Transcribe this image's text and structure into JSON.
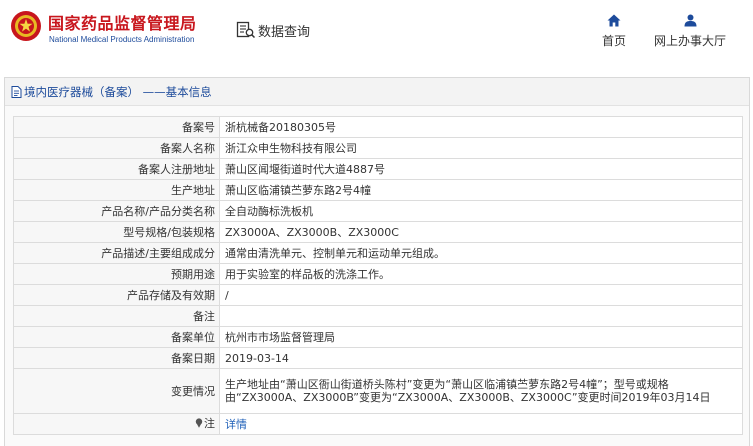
{
  "header": {
    "site_name": "国家药品监督管理局",
    "site_name_en": "National Medical Products Administration",
    "data_query": "数据查询",
    "nav": [
      {
        "label": "首页",
        "icon": "home-icon"
      },
      {
        "label": "网上办事大厅",
        "icon": "user-icon"
      }
    ]
  },
  "panel": {
    "title": "境内医疗器械（备案） ——基本信息",
    "icon": "document-icon"
  },
  "rows": [
    {
      "key": "备案号",
      "value": "浙杭械备20180305号"
    },
    {
      "key": "备案人名称",
      "value": "浙江众申生物科技有限公司"
    },
    {
      "key": "备案人注册地址",
      "value": "萧山区闻堰街道时代大道4887号"
    },
    {
      "key": "生产地址",
      "value": "萧山区临浦镇苎萝东路2号4幢"
    },
    {
      "key": "产品名称/产品分类名称",
      "value": "全自动酶标洗板机"
    },
    {
      "key": "型号规格/包装规格",
      "value": "ZX3000A、ZX3000B、ZX3000C"
    },
    {
      "key": "产品描述/主要组成成分",
      "value": "通常由清洗单元、控制单元和运动单元组成。"
    },
    {
      "key": "预期用途",
      "value": "用于实验室的样品板的洗涤工作。"
    },
    {
      "key": "产品存储及有效期",
      "value": "/"
    },
    {
      "key": "备注",
      "value": ""
    },
    {
      "key": "备案单位",
      "value": "杭州市市场监督管理局"
    },
    {
      "key": "备案日期",
      "value": "2019-03-14"
    },
    {
      "key": "变更情况",
      "value": "生产地址由“萧山区衙山街道桥头陈村”变更为“萧山区临浦镇苎萝东路2号4幢”；型号或规格由“ZX3000A、ZX3000B”变更为“ZX3000A、ZX3000B、ZX3000C”变更时间2019年03月14日"
    }
  ],
  "note": {
    "key": "注",
    "link": "详情",
    "icon": "pin-icon"
  }
}
